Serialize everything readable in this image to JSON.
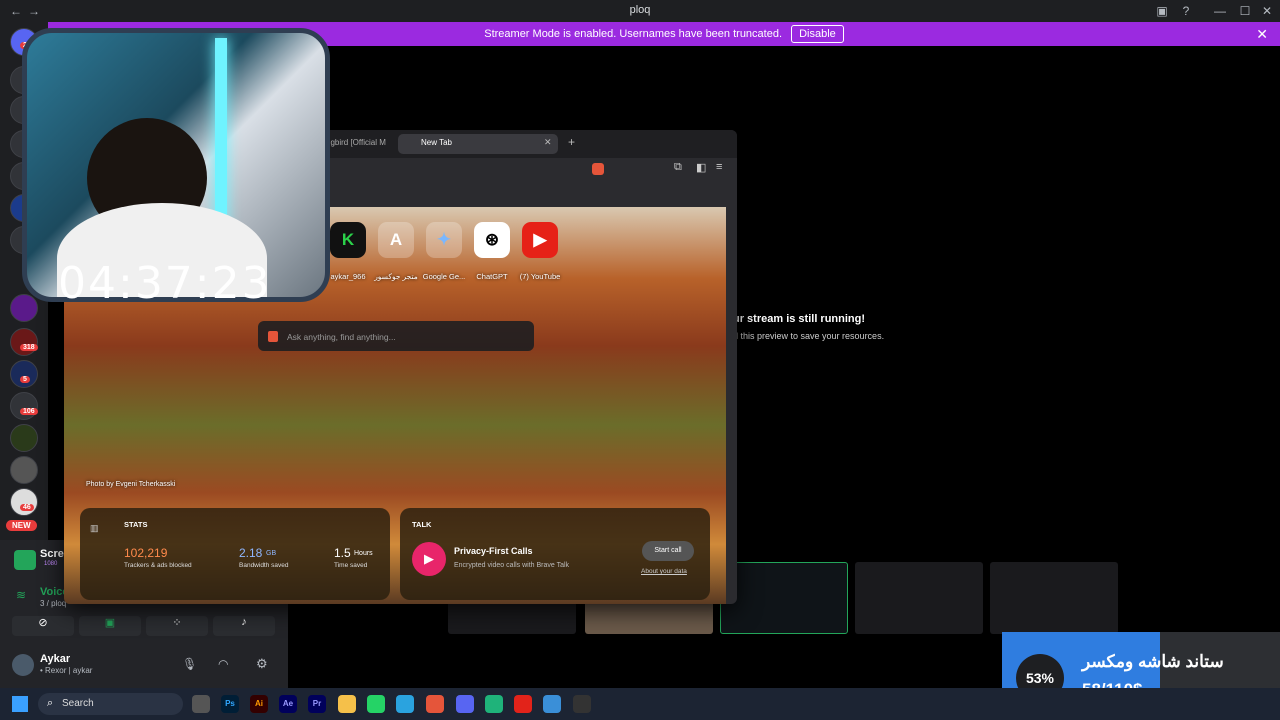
{
  "window": {
    "title": "ploq",
    "nav_back": "←",
    "nav_forward": "→",
    "minimize": "—",
    "maximize": "☐",
    "close": "✕",
    "help": "?",
    "inbox": "▣"
  },
  "banner": {
    "text": "Streamer Mode is enabled. Usernames have been truncated.",
    "button": "Disable",
    "close": "✕"
  },
  "guild_badges": [
    "21",
    "318",
    "5",
    "106",
    "46"
  ],
  "new_badge": "NEW",
  "channels": {
    "stream_label": "Scree",
    "stream_quality": "1080",
    "voice_label": "Voice",
    "voice_sub": "3 / ploq",
    "user_name": "Aykar",
    "user_status": "• Rexor | aykar"
  },
  "stage": {
    "heading": "ur stream is still running!",
    "subtext": "d this preview to save your resources."
  },
  "browser": {
    "tab_prev": "ngbird [Official M",
    "tab_active": "New Tab",
    "new_tab": "+",
    "search_placeholder": "Ask anything, find anything...",
    "photo_credit": "Photo by Evgeni Tcherkasski",
    "shortcuts": [
      {
        "label": "aykar_966",
        "glyph": "K"
      },
      {
        "label": "متجر جوكسور",
        "glyph": "A"
      },
      {
        "label": "Google Ge...",
        "glyph": "✦"
      },
      {
        "label": "ChatGPT",
        "glyph": "⊛"
      },
      {
        "label": "(7) YouTube",
        "glyph": "▶"
      }
    ],
    "stats": {
      "title": "STATS",
      "trackers": "102,219",
      "trackers_label": "Trackers & ads blocked",
      "bandwidth": "2.18",
      "bandwidth_unit": "GB",
      "bandwidth_label": "Bandwidth saved",
      "time": "1.5",
      "time_unit": "Hours",
      "time_label": "Time saved"
    },
    "talk": {
      "title": "TALK",
      "heading": "Privacy-First Calls",
      "sub": "Encrypted video calls with Brave Talk",
      "button": "Start call",
      "link": "About your data"
    }
  },
  "clock": "04:37:23",
  "donation": {
    "percent": "53%",
    "title": "ستاند شاشه ومكسر",
    "amount": "58/110$"
  },
  "taskbar": {
    "search": "Search",
    "apps": [
      "Ps",
      "Ai",
      "Ae",
      "Pr"
    ]
  },
  "colors": {
    "banner": "#9b2ae0",
    "accent": "#2f7de0"
  }
}
